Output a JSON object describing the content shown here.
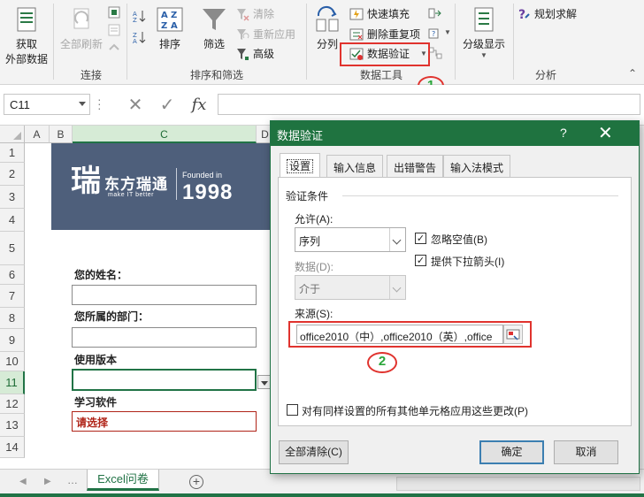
{
  "ribbon": {
    "get_external_data": [
      "获取",
      "外部数据"
    ],
    "refresh_all": "全部刷新",
    "sort": "排序",
    "filter": "筛选",
    "clear": "清除",
    "reapply": "重新应用",
    "advanced": "高级",
    "text_to_columns": "分列",
    "flash_fill": "快速填充",
    "remove_duplicates": "删除重复项",
    "data_validation": "数据验证",
    "outline": "分级显示",
    "solver": "规划求解",
    "groups": {
      "connections": "连接",
      "sort_filter": "排序和筛选",
      "data_tools": "数据工具",
      "analysis": "分析"
    },
    "callout_1": "1"
  },
  "formula_bar": {
    "name_box": "C11",
    "formula": ""
  },
  "sheet": {
    "columns": [
      "A",
      "B",
      "C",
      "D"
    ],
    "rows": [
      "1",
      "2",
      "3",
      "4",
      "5",
      "6",
      "7",
      "8",
      "9",
      "10",
      "11",
      "12",
      "13",
      "14"
    ],
    "selected_col": "C",
    "selected_row": "11",
    "banner": {
      "glyph": "瑞",
      "company": "东方瑞通",
      "slogan": "make IT better",
      "founded": "Founded in",
      "year": "1998"
    },
    "form": {
      "name_label": "您的姓名：",
      "dept_label": "您所属的部门：",
      "version_label": "使用版本",
      "software_label": "学习软件",
      "software_value": "请选择"
    },
    "tab_name": "Excel问卷"
  },
  "dialog": {
    "title": "数据验证",
    "help": "?",
    "close": "✕",
    "tabs": [
      "设置",
      "输入信息",
      "出错警告",
      "输入法模式"
    ],
    "criteria_label": "验证条件",
    "allow_label": "允许(A):",
    "allow_value": "序列",
    "ignore_blank": "忽略空值(B)",
    "in_cell_dropdown": "提供下拉箭头(I)",
    "data_label": "数据(D):",
    "data_value": "介于",
    "source_label": "来源(S):",
    "source_value": "office2010（中）,office2010（英）,office",
    "apply_all": "对有同样设置的所有其他单元格应用这些更改(P)",
    "clear_all": "全部清除(C)",
    "ok": "确定",
    "cancel": "取消",
    "callout_2": "2"
  },
  "colors": {
    "excel_green": "#217346",
    "highlight_red": "#e0332e",
    "banner_navy": "#4e5f7b"
  }
}
